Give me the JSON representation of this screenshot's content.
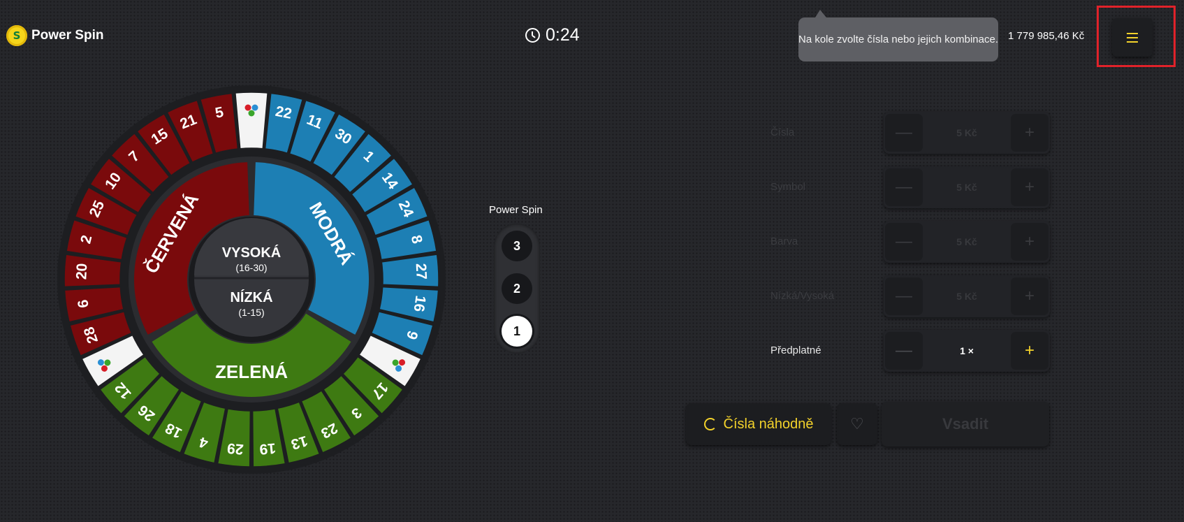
{
  "header": {
    "logo_text": "Power Spin",
    "logo_icon": "power-spin-logo-icon",
    "timer": "0:24",
    "tooltip": "Na kole zvolte čísla nebo jejich kombinace.",
    "balance": "1 779 985,46 Kč",
    "menu_icon": "hamburger-menu-icon"
  },
  "wheel": {
    "outer_numbers": {
      "red": [
        "28",
        "6",
        "20",
        "2",
        "25",
        "10",
        "7",
        "15",
        "21",
        "5"
      ],
      "blue": [
        "22",
        "11",
        "30",
        "1",
        "14",
        "24",
        "8",
        "27",
        "16",
        "9"
      ],
      "green": [
        "17",
        "3",
        "23",
        "13",
        "19",
        "29",
        "4",
        "18",
        "26",
        "12"
      ]
    },
    "middle": {
      "red": "ČERVENÁ",
      "blue": "MODRÁ",
      "green": "ZELENÁ"
    },
    "center": {
      "high_label": "VYSOKÁ",
      "high_range": "(16-30)",
      "low_label": "NÍZKÁ",
      "low_range": "(1-15)"
    },
    "colors": {
      "red": "#7a0a0c",
      "blue": "#1d7fb4",
      "green": "#3e7a12",
      "hub": "#35363b"
    },
    "symbol_icon": "tricolor-symbol-icon"
  },
  "power_spin": {
    "label": "Power Spin",
    "options": [
      "3",
      "2",
      "1"
    ],
    "selected": "1"
  },
  "bets": {
    "rows": [
      {
        "label": "Čísla",
        "value": "5 Kč"
      },
      {
        "label": "Symbol",
        "value": "5 Kč"
      },
      {
        "label": "Barva",
        "value": "5 Kč"
      },
      {
        "label": "Nízká/Vysoká",
        "value": "5 Kč"
      },
      {
        "label": "Předplatné",
        "value": "1 ×"
      }
    ],
    "minus_symbol": "—",
    "plus_symbol": "+"
  },
  "actions": {
    "random_label": "Čísla náhodně",
    "favorite_icon": "heart-icon",
    "favorite_symbol": "♡",
    "submit_label": "Vsadit"
  }
}
